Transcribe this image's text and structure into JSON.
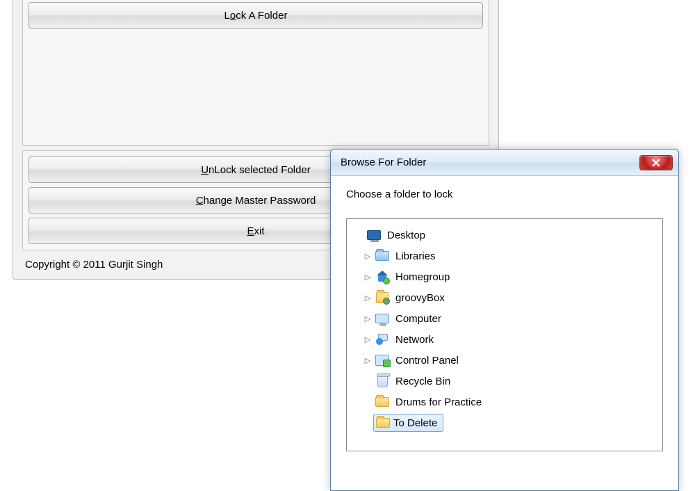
{
  "app": {
    "buttons": {
      "lock_pre": "L",
      "lock_u": "o",
      "lock_post": "ck A Folder",
      "unlock_pre": "",
      "unlock_u": "U",
      "unlock_post": "nLock selected Folder",
      "change_pre": "",
      "change_u": "C",
      "change_post": "hange Master Password",
      "exit_pre": "",
      "exit_u": "E",
      "exit_post": "xit"
    },
    "copyright": "Copyright © 2011 Gurjit Singh"
  },
  "dialog": {
    "title": "Browse For Folder",
    "prompt": "Choose a folder to lock",
    "tree": {
      "desktop": "Desktop",
      "libraries": "Libraries",
      "homegroup": "Homegroup",
      "user": "groovyBox",
      "computer": "Computer",
      "network": "Network",
      "control_panel": "Control Panel",
      "recycle_bin": "Recycle Bin",
      "drums": "Drums for Practice",
      "to_delete": "To Delete"
    }
  }
}
